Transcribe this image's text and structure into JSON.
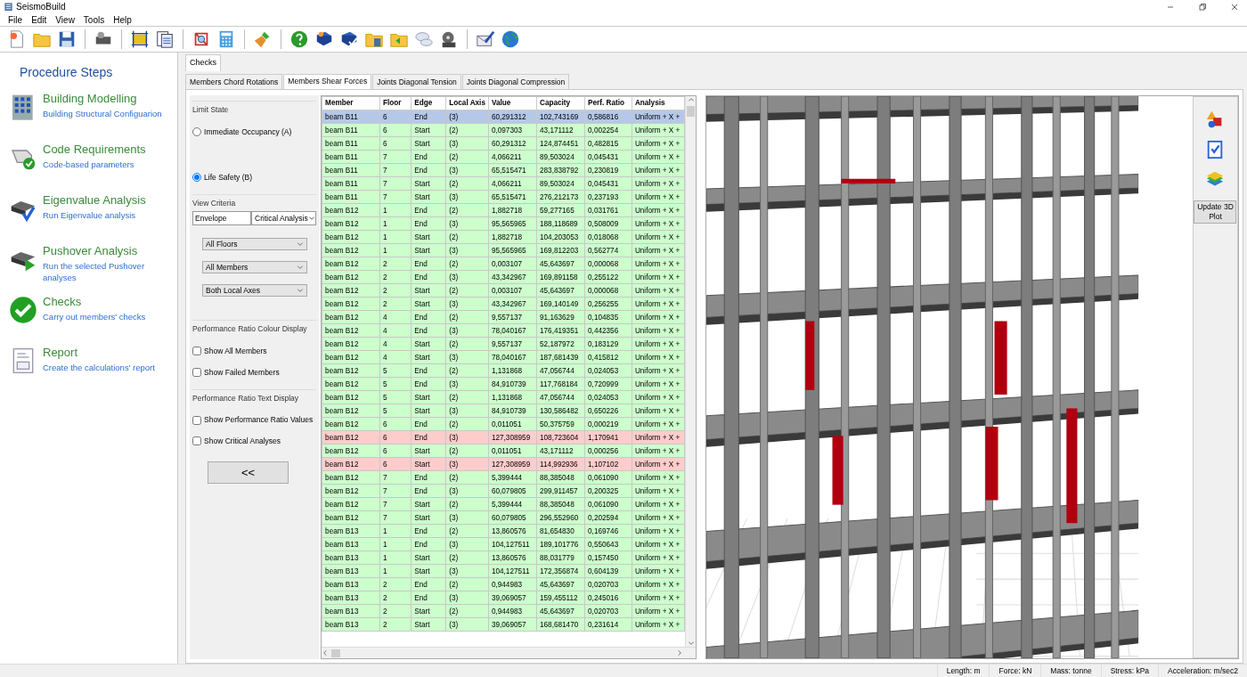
{
  "window": {
    "title": "SeismoBuild"
  },
  "menu": [
    "File",
    "Edit",
    "View",
    "Tools",
    "Help"
  ],
  "procedure": {
    "title": "Procedure Steps",
    "steps": [
      {
        "title": "Building Modelling",
        "subtitle": "Building Structural Configuarion"
      },
      {
        "title": "Code Requirements",
        "subtitle": "Code-based parameters"
      },
      {
        "title": "Eigenvalue Analysis",
        "subtitle": "Run Eigenvalue analysis"
      },
      {
        "title": "Pushover Analysis",
        "subtitle": "Run the selected Pushover analyses"
      },
      {
        "title": "Checks",
        "subtitle": "Carry out members' checks"
      },
      {
        "title": "Report",
        "subtitle": "Create the calculations' report"
      }
    ]
  },
  "main_tabs": [
    {
      "label": "Checks",
      "selected": true
    }
  ],
  "sub_tabs": [
    {
      "label": "Members Chord Rotations",
      "selected": false
    },
    {
      "label": "Members Shear Forces",
      "selected": true
    },
    {
      "label": "Joints Diagonal Tension",
      "selected": false
    },
    {
      "label": "Joints Diagonal Compression",
      "selected": false
    }
  ],
  "options": {
    "limit_state": {
      "title": "Limit State",
      "options": [
        {
          "label": "Immediate Occupancy (A)",
          "selected": false
        },
        {
          "label": "Life Safety (B)",
          "selected": true
        }
      ]
    },
    "view_criteria": {
      "title": "View Criteria",
      "envelope": "Envelope",
      "analysis": "Critical Analysis",
      "filters": [
        "All Floors",
        "All Members",
        "Both Local Axes"
      ]
    },
    "colour_display": {
      "title": "Performance Ratio Colour Display",
      "checkboxes": [
        {
          "label": "Show All Members",
          "checked": false
        },
        {
          "label": "Show Failed Members",
          "checked": false
        }
      ]
    },
    "text_display": {
      "title": "Performance Ratio Text Display",
      "checkboxes": [
        {
          "label": "Show Performance Ratio Values",
          "checked": false
        },
        {
          "label": "Show Critical Analyses",
          "checked": false
        }
      ]
    },
    "collapse_button": "<<"
  },
  "table": {
    "columns": [
      "Member",
      "Floor",
      "Edge",
      "Local Axis",
      "Value",
      "Capacity",
      "Perf. Ratio",
      "Analysis"
    ],
    "rows": [
      {
        "cells": [
          "beam B11",
          "6",
          "End",
          "(3)",
          "60,291312",
          "102,743169",
          "0,586816",
          "Uniform + X +"
        ],
        "selected": true,
        "failed": false
      },
      {
        "cells": [
          "beam B11",
          "6",
          "Start",
          "(2)",
          "0,097303",
          "43,171112",
          "0,002254",
          "Uniform + X +"
        ],
        "selected": false,
        "failed": false
      },
      {
        "cells": [
          "beam B11",
          "6",
          "Start",
          "(3)",
          "60,291312",
          "124,874451",
          "0,482815",
          "Uniform + X +"
        ],
        "selected": false,
        "failed": false
      },
      {
        "cells": [
          "beam B11",
          "7",
          "End",
          "(2)",
          "4,066211",
          "89,503024",
          "0,045431",
          "Uniform + X +"
        ],
        "selected": false,
        "failed": false
      },
      {
        "cells": [
          "beam B11",
          "7",
          "End",
          "(3)",
          "65,515471",
          "283,838792",
          "0,230819",
          "Uniform + X +"
        ],
        "selected": false,
        "failed": false
      },
      {
        "cells": [
          "beam B11",
          "7",
          "Start",
          "(2)",
          "4,066211",
          "89,503024",
          "0,045431",
          "Uniform + X +"
        ],
        "selected": false,
        "failed": false
      },
      {
        "cells": [
          "beam B11",
          "7",
          "Start",
          "(3)",
          "65,515471",
          "276,212173",
          "0,237193",
          "Uniform + X +"
        ],
        "selected": false,
        "failed": false
      },
      {
        "cells": [
          "beam B12",
          "1",
          "End",
          "(2)",
          "1,882718",
          "59,277165",
          "0,031761",
          "Uniform + X +"
        ],
        "selected": false,
        "failed": false
      },
      {
        "cells": [
          "beam B12",
          "1",
          "End",
          "(3)",
          "95,565965",
          "188,118689",
          "0,508009",
          "Uniform + X +"
        ],
        "selected": false,
        "failed": false
      },
      {
        "cells": [
          "beam B12",
          "1",
          "Start",
          "(2)",
          "1,882718",
          "104,203053",
          "0,018068",
          "Uniform + X +"
        ],
        "selected": false,
        "failed": false
      },
      {
        "cells": [
          "beam B12",
          "1",
          "Start",
          "(3)",
          "95,565965",
          "169,812203",
          "0,562774",
          "Uniform + X +"
        ],
        "selected": false,
        "failed": false
      },
      {
        "cells": [
          "beam B12",
          "2",
          "End",
          "(2)",
          "0,003107",
          "45,643697",
          "0,000068",
          "Uniform + X +"
        ],
        "selected": false,
        "failed": false
      },
      {
        "cells": [
          "beam B12",
          "2",
          "End",
          "(3)",
          "43,342967",
          "169,891158",
          "0,255122",
          "Uniform + X +"
        ],
        "selected": false,
        "failed": false
      },
      {
        "cells": [
          "beam B12",
          "2",
          "Start",
          "(2)",
          "0,003107",
          "45,643697",
          "0,000068",
          "Uniform + X +"
        ],
        "selected": false,
        "failed": false
      },
      {
        "cells": [
          "beam B12",
          "2",
          "Start",
          "(3)",
          "43,342967",
          "169,140149",
          "0,256255",
          "Uniform + X +"
        ],
        "selected": false,
        "failed": false
      },
      {
        "cells": [
          "beam B12",
          "4",
          "End",
          "(2)",
          "9,557137",
          "91,163629",
          "0,104835",
          "Uniform + X +"
        ],
        "selected": false,
        "failed": false
      },
      {
        "cells": [
          "beam B12",
          "4",
          "End",
          "(3)",
          "78,040167",
          "176,419351",
          "0,442356",
          "Uniform + X +"
        ],
        "selected": false,
        "failed": false
      },
      {
        "cells": [
          "beam B12",
          "4",
          "Start",
          "(2)",
          "9,557137",
          "52,187972",
          "0,183129",
          "Uniform + X +"
        ],
        "selected": false,
        "failed": false
      },
      {
        "cells": [
          "beam B12",
          "4",
          "Start",
          "(3)",
          "78,040167",
          "187,681439",
          "0,415812",
          "Uniform + X +"
        ],
        "selected": false,
        "failed": false
      },
      {
        "cells": [
          "beam B12",
          "5",
          "End",
          "(2)",
          "1,131868",
          "47,056744",
          "0,024053",
          "Uniform + X +"
        ],
        "selected": false,
        "failed": false
      },
      {
        "cells": [
          "beam B12",
          "5",
          "End",
          "(3)",
          "84,910739",
          "117,768184",
          "0,720999",
          "Uniform + X +"
        ],
        "selected": false,
        "failed": false
      },
      {
        "cells": [
          "beam B12",
          "5",
          "Start",
          "(2)",
          "1,131868",
          "47,056744",
          "0,024053",
          "Uniform + X +"
        ],
        "selected": false,
        "failed": false
      },
      {
        "cells": [
          "beam B12",
          "5",
          "Start",
          "(3)",
          "84,910739",
          "130,586482",
          "0,650226",
          "Uniform + X +"
        ],
        "selected": false,
        "failed": false
      },
      {
        "cells": [
          "beam B12",
          "6",
          "End",
          "(2)",
          "0,011051",
          "50,375759",
          "0,000219",
          "Uniform + X +"
        ],
        "selected": false,
        "failed": false
      },
      {
        "cells": [
          "beam B12",
          "6",
          "End",
          "(3)",
          "127,308959",
          "108,723604",
          "1,170941",
          "Uniform + X +"
        ],
        "selected": false,
        "failed": true
      },
      {
        "cells": [
          "beam B12",
          "6",
          "Start",
          "(2)",
          "0,011051",
          "43,171112",
          "0,000256",
          "Uniform + X +"
        ],
        "selected": false,
        "failed": false
      },
      {
        "cells": [
          "beam B12",
          "6",
          "Start",
          "(3)",
          "127,308959",
          "114,992936",
          "1,107102",
          "Uniform + X +"
        ],
        "selected": false,
        "failed": true
      },
      {
        "cells": [
          "beam B12",
          "7",
          "End",
          "(2)",
          "5,399444",
          "88,385048",
          "0,061090",
          "Uniform + X +"
        ],
        "selected": false,
        "failed": false
      },
      {
        "cells": [
          "beam B12",
          "7",
          "End",
          "(3)",
          "60,079805",
          "299,911457",
          "0,200325",
          "Uniform + X +"
        ],
        "selected": false,
        "failed": false
      },
      {
        "cells": [
          "beam B12",
          "7",
          "Start",
          "(2)",
          "5,399444",
          "88,385048",
          "0,061090",
          "Uniform + X +"
        ],
        "selected": false,
        "failed": false
      },
      {
        "cells": [
          "beam B12",
          "7",
          "Start",
          "(3)",
          "60,079805",
          "296,552960",
          "0,202594",
          "Uniform + X +"
        ],
        "selected": false,
        "failed": false
      },
      {
        "cells": [
          "beam B13",
          "1",
          "End",
          "(2)",
          "13,860576",
          "81,654830",
          "0,169746",
          "Uniform + X +"
        ],
        "selected": false,
        "failed": false
      },
      {
        "cells": [
          "beam B13",
          "1",
          "End",
          "(3)",
          "104,127511",
          "189,101776",
          "0,550643",
          "Uniform + X +"
        ],
        "selected": false,
        "failed": false
      },
      {
        "cells": [
          "beam B13",
          "1",
          "Start",
          "(2)",
          "13,860576",
          "88,031779",
          "0,157450",
          "Uniform + X +"
        ],
        "selected": false,
        "failed": false
      },
      {
        "cells": [
          "beam B13",
          "1",
          "Start",
          "(3)",
          "104,127511",
          "172,356874",
          "0,604139",
          "Uniform + X +"
        ],
        "selected": false,
        "failed": false
      },
      {
        "cells": [
          "beam B13",
          "2",
          "End",
          "(2)",
          "0,944983",
          "45,643697",
          "0,020703",
          "Uniform + X +"
        ],
        "selected": false,
        "failed": false
      },
      {
        "cells": [
          "beam B13",
          "2",
          "End",
          "(3)",
          "39,069057",
          "159,455112",
          "0,245016",
          "Uniform + X +"
        ],
        "selected": false,
        "failed": false
      },
      {
        "cells": [
          "beam B13",
          "2",
          "Start",
          "(2)",
          "0,944983",
          "45,643697",
          "0,020703",
          "Uniform + X +"
        ],
        "selected": false,
        "failed": false
      },
      {
        "cells": [
          "beam B13",
          "2",
          "Start",
          "(3)",
          "39,069057",
          "168,681470",
          "0,231614",
          "Uniform + X +"
        ],
        "selected": false,
        "failed": false
      }
    ]
  },
  "plot_tools": {
    "update_button": "Update 3D Plot"
  },
  "status_bar": [
    "Length: m",
    "Force: kN",
    "Mass: tonne",
    "Stress: kPa",
    "Acceleration: m/sec2"
  ]
}
